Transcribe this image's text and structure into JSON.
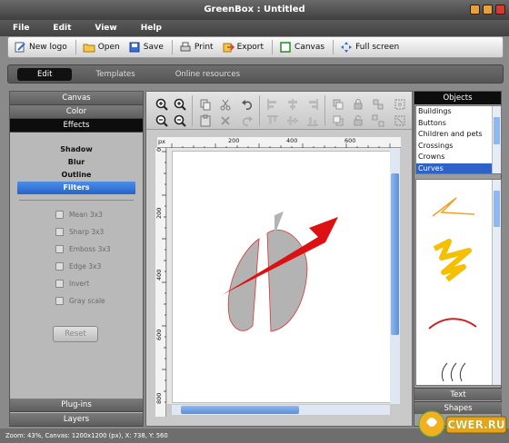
{
  "window": {
    "title": "GreenBox : Untitled"
  },
  "menu": [
    "File",
    "Edit",
    "View",
    "Help"
  ],
  "toolbar": [
    {
      "label": "New logo",
      "icon": "new-logo-icon"
    },
    {
      "label": "Open",
      "icon": "folder-icon"
    },
    {
      "label": "Save",
      "icon": "disk-icon"
    },
    {
      "label": "Print",
      "icon": "printer-icon"
    },
    {
      "label": "Export",
      "icon": "export-icon"
    },
    {
      "label": "Canvas",
      "icon": "canvas-icon"
    },
    {
      "label": "Full screen",
      "icon": "fullscreen-icon"
    }
  ],
  "modes": [
    "Edit",
    "Templates",
    "Online resources"
  ],
  "left_panel": {
    "sections": [
      "Canvas",
      "Color",
      "Effects"
    ],
    "effects": [
      "Shadow",
      "Blur",
      "Outline",
      "Filters"
    ],
    "filters": [
      "Mean 3x3",
      "Sharp 3x3",
      "Emboss 3x3",
      "Edge 3x3",
      "Invert",
      "Gray scale"
    ],
    "reset_label": "Reset",
    "footer": [
      "Plug-ins",
      "Layers"
    ]
  },
  "ruler": {
    "unit": "px",
    "top_ticks": [
      "200",
      "400",
      "600"
    ],
    "left_ticks": [
      "0",
      "200",
      "400",
      "600",
      "800"
    ]
  },
  "right_panel": {
    "header": "Objects",
    "objects": [
      "Buildings",
      "Buttons",
      "Children and pets",
      "Crossings",
      "Crowns",
      "Curves"
    ],
    "selected_object": "Curves",
    "footer": [
      "Text",
      "Shapes"
    ]
  },
  "status": "Zoom: 43%, Canvas: 1200x1200 (px), X: 738, Y: 560",
  "brand": "CWER.RU",
  "colors": {
    "accent": "#2d63c9",
    "arrow": "#dd1111",
    "shape_gray": "#b3b3b3"
  }
}
